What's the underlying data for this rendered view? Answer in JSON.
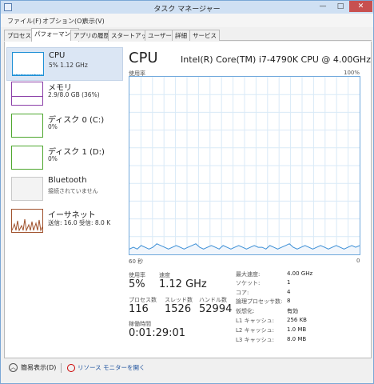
{
  "window": {
    "title": "タスク マネージャー",
    "minimize": "—",
    "maximize": "□",
    "close": "✕"
  },
  "menu": [
    "ファイル(F)",
    "オプション(O)",
    "表示(V)"
  ],
  "tabs": [
    "プロセス",
    "パフォーマンス",
    "アプリの履歴",
    "スタートアップ",
    "ユーザー",
    "詳細",
    "サービス"
  ],
  "active_tab": "パフォーマンス",
  "sidebar": [
    {
      "name": "CPU",
      "sub": "5% 1.12 GHz",
      "color": "#1e90d6"
    },
    {
      "name": "メモリ",
      "sub": "2.9/8.0 GB (36%)",
      "color": "#8b3fa8"
    },
    {
      "name": "ディスク 0 (C:)",
      "sub": "0%",
      "color": "#4ea72e"
    },
    {
      "name": "ディスク 1 (D:)",
      "sub": "0%",
      "color": "#4ea72e"
    },
    {
      "name": "Bluetooth",
      "sub": "接続されていません",
      "color": "#999999"
    },
    {
      "name": "イーサネット",
      "sub": "送信: 16.0 受信: 8.0 K",
      "color": "#a0522d"
    }
  ],
  "main": {
    "title": "CPU",
    "cpu_name": "Intel(R) Core(TM) i7-4790K CPU @ 4.00GHz",
    "graph_top_left": "使用率",
    "graph_top_right": "100%",
    "graph_bottom_left": "60 秒",
    "graph_bottom_right": "0",
    "usage_label": "使用率",
    "usage_value": "5%",
    "speed_label": "速度",
    "speed_value": "1.12 GHz",
    "processes_label": "プロセス数",
    "processes_value": "116",
    "threads_label": "スレッド数",
    "threads_value": "1526",
    "handles_label": "ハンドル数",
    "handles_value": "52994",
    "uptime_label": "稼働時間",
    "uptime_value": "0:01:29:01",
    "specs": [
      {
        "label": "最大速度:",
        "value": "4.00 GHz"
      },
      {
        "label": "ソケット:",
        "value": "1"
      },
      {
        "label": "コア:",
        "value": "4"
      },
      {
        "label": "論理プロセッサ数:",
        "value": "8"
      },
      {
        "label": "仮想化:",
        "value": "有効"
      },
      {
        "label": "L1 キャッシュ:",
        "value": "256 KB"
      },
      {
        "label": "L2 キャッシュ:",
        "value": "1.0 MB"
      },
      {
        "label": "L3 キャッシュ:",
        "value": "8.0 MB"
      }
    ]
  },
  "footer": {
    "fewer_details": "簡易表示(D)",
    "resource_monitor": "リソース モニターを開く"
  },
  "cpu_usage_history": [
    3,
    4,
    3,
    5,
    4,
    3,
    4,
    6,
    5,
    4,
    3,
    4,
    5,
    4,
    3,
    4,
    5,
    6,
    4,
    3,
    4,
    5,
    4,
    3,
    5,
    4,
    3,
    4,
    5,
    4,
    3,
    4,
    5,
    4,
    4,
    3,
    5,
    4,
    3,
    4,
    5,
    6,
    4,
    3,
    4,
    5,
    4,
    3,
    4,
    5,
    4,
    3,
    4,
    5,
    4,
    3,
    4,
    5,
    4,
    5
  ]
}
